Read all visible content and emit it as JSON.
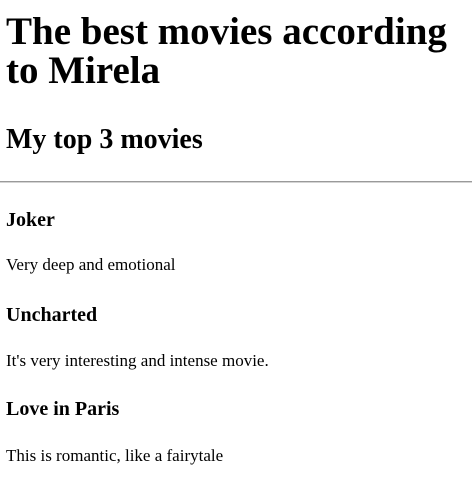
{
  "page": {
    "title": "The best movies according to Mirela",
    "subtitle": "My top 3 movies"
  },
  "movies": [
    {
      "name": "Joker",
      "description": "Very deep and emotional"
    },
    {
      "name": "Uncharted",
      "description": "It's very interesting and intense movie."
    },
    {
      "name": "Love in Paris",
      "description": "This is romantic, like a fairytale"
    }
  ]
}
